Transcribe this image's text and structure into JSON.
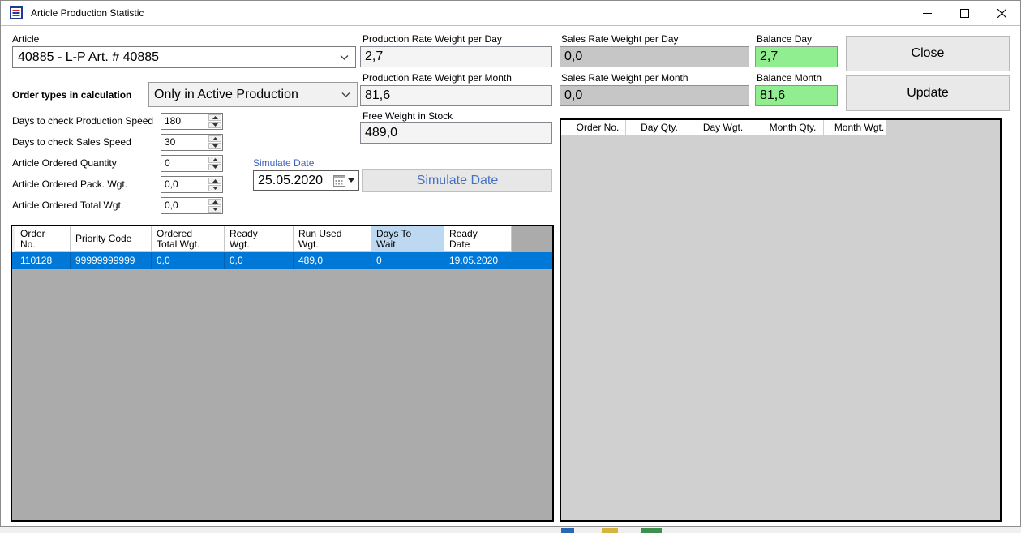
{
  "window": {
    "title": "Article Production Statistic",
    "controls": {
      "minimize": "minimize",
      "maximize": "maximize",
      "close": "close"
    }
  },
  "colors": {
    "selection_blue": "#0078d7",
    "balance_green": "#90ee90",
    "sales_silver": "#c6c6c6",
    "days_to_wait_header": "#bdd9f2",
    "link_blue": "#3b5fc0",
    "grid_left_body": "#ababab",
    "grid_right_body": "#d0d0d0"
  },
  "form": {
    "article": {
      "label": "Article",
      "value": "40885 - L-P Art. # 40885"
    },
    "order_types": {
      "label": "Order types in calculation",
      "value": "Only in Active Production"
    },
    "spinners": [
      {
        "label": "Days to check Production Speed",
        "value": "180"
      },
      {
        "label": "Days to check Sales Speed",
        "value": "30"
      },
      {
        "label": "Article Ordered Quantity",
        "value": "0"
      },
      {
        "label": "Article Ordered Pack. Wgt.",
        "value": "0,0"
      },
      {
        "label": "Article Ordered Total Wgt.",
        "value": "0,0"
      }
    ],
    "production": [
      {
        "label": "Production Rate Weight per Day",
        "value": "2,7"
      },
      {
        "label": "Production Rate Weight per Month",
        "value": "81,6"
      },
      {
        "label": "Free Weight in Stock",
        "value": "489,0"
      }
    ],
    "sales": [
      {
        "label": "Sales Rate Weight per Day",
        "value": "0,0"
      },
      {
        "label": "Sales Rate Weight per Month",
        "value": "0,0"
      }
    ],
    "balance": [
      {
        "label": "Balance Day",
        "value": "2,7"
      },
      {
        "label": "Balance Month",
        "value": "81,6"
      }
    ],
    "simulate": {
      "label": "Simulate Date",
      "date": "25.05.2020",
      "button": "Simulate Date"
    },
    "buttons": {
      "close": "Close",
      "update": "Update"
    }
  },
  "orders_grid": {
    "columns": [
      {
        "l1": "Order",
        "l2": "No."
      },
      {
        "l1": "Priority Code",
        "l2": ""
      },
      {
        "l1": "Ordered",
        "l2": "Total Wgt."
      },
      {
        "l1": "Ready",
        "l2": "Wgt."
      },
      {
        "l1": "Run Used",
        "l2": "Wgt."
      },
      {
        "l1": "Days To",
        "l2": "Wait"
      },
      {
        "l1": "Ready",
        "l2": "Date"
      }
    ],
    "rows": [
      [
        "110128",
        "99999999999",
        "0,0",
        "0,0",
        "489,0",
        "0",
        "19.05.2020"
      ]
    ]
  },
  "stats_grid": {
    "columns": [
      "Order No.",
      "Day Qty.",
      "Day Wgt.",
      "Month Qty.",
      "Month Wgt."
    ],
    "rows": []
  }
}
